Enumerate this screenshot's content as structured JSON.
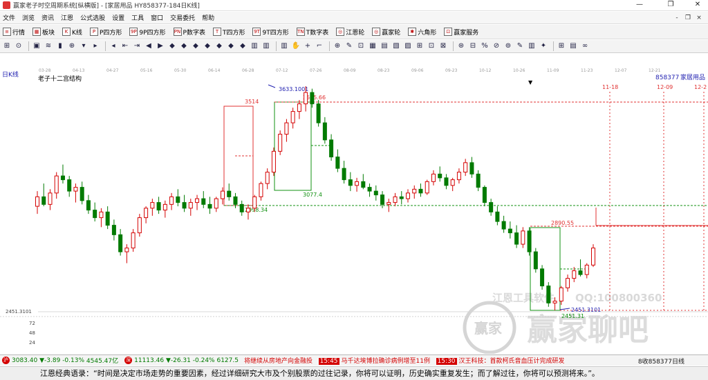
{
  "window": {
    "title": "赢家老子时空周期系统[纵横版] - [家居用品  HY858377-184日K线]",
    "minimize_glyph": "—",
    "maximize_glyph": "❐",
    "close_glyph": "✕"
  },
  "menu": {
    "items": [
      "文件",
      "浏览",
      "资讯",
      "江恩",
      "公式选股",
      "设置",
      "工具",
      "窗口",
      "交易委托",
      "帮助"
    ],
    "mdi_minimize": "-",
    "mdi_restore": "❐",
    "mdi_close": "×"
  },
  "toolbar1": {
    "items": [
      {
        "label": "行情",
        "icon": "≡"
      },
      {
        "label": "板块",
        "icon": "▦"
      },
      {
        "label": "K线",
        "icon": "K"
      },
      {
        "label": "P四方形",
        "icon": "P"
      },
      {
        "label": "9P四方形",
        "icon": "9P"
      },
      {
        "label": "P数字表",
        "icon": "PN"
      },
      {
        "label": "T四方形",
        "icon": "T"
      },
      {
        "label": "9T四方形",
        "icon": "9T"
      },
      {
        "label": "T数字表",
        "icon": "TN"
      },
      {
        "label": "江恩轮",
        "icon": "◎"
      },
      {
        "label": "赢家轮",
        "icon": "◎"
      },
      {
        "label": "六角形",
        "icon": "✱"
      },
      {
        "label": "赢家服务",
        "icon": "⊡"
      }
    ]
  },
  "toolbar2": {
    "icons": [
      "⊞",
      "⊙",
      "▣",
      "≋",
      "▮",
      "⊕",
      "▾",
      "▸",
      "◂",
      "⇤",
      "⇥",
      "◀",
      "▶",
      "◆",
      "◆",
      "◆",
      "◆",
      "◆",
      "◆",
      "◆",
      "▥",
      "▥",
      "▥",
      "✋",
      "+",
      "⌐",
      "⊕",
      "✎",
      "⊡",
      "▦",
      "▤",
      "▧",
      "▨",
      "⊞",
      "⊡",
      "⊠",
      "⊛",
      "⊟",
      "%",
      "⊘",
      "⊚",
      "✎",
      "▥",
      "✦",
      "⊞",
      "▤",
      "∞"
    ]
  },
  "chart": {
    "period_label": "日K线",
    "structure_label": "老子十二宫结构",
    "code": "858377",
    "name": "家居用品",
    "date_ticks": [
      "03-28",
      "04-13",
      "04-27",
      "05-16",
      "05-30",
      "06-14",
      "06-28",
      "07-12",
      "07-26",
      "08-09",
      "08-23",
      "09-06",
      "09-23",
      "10-12",
      "10-26",
      "11-09",
      "11-23",
      "12-07",
      "12-21"
    ],
    "forecast_dates": [
      "11-18",
      "12-09",
      "12-2"
    ],
    "price_labels": {
      "high": "3633.1001",
      "box_top_left": "3514",
      "box_top_right": "3535.66",
      "box_bottom": "2998.34",
      "mid_low": "3077.4",
      "right_level": "2890.55",
      "low_a": "2451.3101",
      "low_b": "2451.31",
      "axis_low": "2451.3101"
    },
    "volume_ticks": [
      "72",
      "48",
      "24"
    ],
    "watermark_1": "江恩工具软件",
    "watermark_2": "QQ:100800360",
    "watermark_3": "赢家聊吧",
    "watermark_logo": "赢家",
    "sort_glyph": "▼",
    "colors": {
      "up": "#d40000",
      "down": "#007a00",
      "box_red": "#e03030",
      "box_green": "#109010",
      "blue_label": "#2020b0"
    }
  },
  "chart_data": {
    "type": "candlestick",
    "title": "家居用品 HY858377 日K线",
    "ohlc_approx": [
      [
        3000,
        3080,
        2960,
        3050
      ],
      [
        3050,
        3120,
        3000,
        3010
      ],
      [
        3010,
        3090,
        2980,
        3070
      ],
      [
        3070,
        3180,
        3040,
        3160
      ],
      [
        3160,
        3220,
        3120,
        3140
      ],
      [
        3140,
        3160,
        3050,
        3080
      ],
      [
        3080,
        3120,
        3020,
        3100
      ],
      [
        3100,
        3130,
        3010,
        3030
      ],
      [
        3030,
        3060,
        2960,
        2980
      ],
      [
        2980,
        3020,
        2920,
        2940
      ],
      [
        2940,
        2990,
        2890,
        2970
      ],
      [
        2970,
        3000,
        2880,
        2900
      ],
      [
        2900,
        2930,
        2820,
        2850
      ],
      [
        2850,
        2880,
        2740,
        2760
      ],
      [
        2760,
        2800,
        2700,
        2780
      ],
      [
        2780,
        2880,
        2760,
        2860
      ],
      [
        2860,
        2960,
        2840,
        2940
      ],
      [
        2940,
        3000,
        2910,
        2990
      ],
      [
        2990,
        3040,
        2950,
        3020
      ],
      [
        3020,
        3050,
        2960,
        2980
      ],
      [
        2980,
        3030,
        2940,
        3010
      ],
      [
        3010,
        3070,
        2980,
        3050
      ],
      [
        3050,
        3090,
        3000,
        3020
      ],
      [
        3020,
        3060,
        2970,
        2990
      ],
      [
        2990,
        3040,
        2950,
        3020
      ],
      [
        3020,
        3060,
        2980,
        3040
      ],
      [
        3040,
        3080,
        2990,
        3010
      ],
      [
        3010,
        3050,
        2960,
        2990
      ],
      [
        2990,
        3050,
        2970,
        3040
      ],
      [
        3040,
        3100,
        3010,
        3080
      ],
      [
        3080,
        3120,
        3030,
        3050
      ],
      [
        3050,
        3070,
        2990,
        3010
      ],
      [
        3010,
        3030,
        2950,
        2970
      ],
      [
        2970,
        3010,
        2930,
        2990
      ],
      [
        2990,
        3060,
        2970,
        3050
      ],
      [
        3050,
        3130,
        3030,
        3120
      ],
      [
        3120,
        3200,
        3090,
        3180
      ],
      [
        3180,
        3310,
        3160,
        3290
      ],
      [
        3290,
        3400,
        3270,
        3380
      ],
      [
        3380,
        3460,
        3340,
        3440
      ],
      [
        3440,
        3520,
        3410,
        3500
      ],
      [
        3500,
        3560,
        3460,
        3540
      ],
      [
        3540,
        3633,
        3500,
        3600
      ],
      [
        3600,
        3620,
        3520,
        3540
      ],
      [
        3540,
        3560,
        3420,
        3440
      ],
      [
        3440,
        3470,
        3330,
        3350
      ],
      [
        3350,
        3380,
        3240,
        3260
      ],
      [
        3260,
        3300,
        3180,
        3200
      ],
      [
        3200,
        3240,
        3120,
        3140
      ],
      [
        3140,
        3180,
        3080,
        3110
      ],
      [
        3110,
        3150,
        3077,
        3130
      ],
      [
        3130,
        3170,
        3090,
        3100
      ],
      [
        3100,
        3120,
        3050,
        3080
      ],
      [
        3080,
        3110,
        3030,
        3060
      ],
      [
        3060,
        3080,
        2990,
        3010
      ],
      [
        3010,
        3040,
        2970,
        3020
      ],
      [
        3020,
        3070,
        3000,
        3050
      ],
      [
        3050,
        3080,
        3010,
        3040
      ],
      [
        3040,
        3090,
        3020,
        3070
      ],
      [
        3070,
        3110,
        3040,
        3090
      ],
      [
        3090,
        3120,
        3050,
        3070
      ],
      [
        3070,
        3140,
        3060,
        3130
      ],
      [
        3130,
        3190,
        3110,
        3170
      ],
      [
        3170,
        3210,
        3130,
        3150
      ],
      [
        3150,
        3170,
        3090,
        3110
      ],
      [
        3110,
        3150,
        3080,
        3140
      ],
      [
        3140,
        3200,
        3120,
        3180
      ],
      [
        3180,
        3250,
        3160,
        3230
      ],
      [
        3230,
        3260,
        3150,
        3170
      ],
      [
        3170,
        3190,
        3080,
        3100
      ],
      [
        3100,
        3110,
        3000,
        3020
      ],
      [
        3020,
        3040,
        2950,
        2970
      ],
      [
        2970,
        3000,
        2900,
        2920
      ],
      [
        2920,
        2950,
        2860,
        2880
      ],
      [
        2880,
        2920,
        2830,
        2860
      ],
      [
        2860,
        2900,
        2780,
        2800
      ],
      [
        2800,
        2890,
        2780,
        2870
      ],
      [
        2870,
        2890,
        2740,
        2760
      ],
      [
        2760,
        2780,
        2650,
        2670
      ],
      [
        2670,
        2690,
        2560,
        2580
      ],
      [
        2580,
        2600,
        2470,
        2490
      ],
      [
        2490,
        2520,
        2451,
        2500
      ],
      [
        2500,
        2580,
        2480,
        2570
      ],
      [
        2570,
        2640,
        2550,
        2620
      ],
      [
        2620,
        2680,
        2600,
        2660
      ],
      [
        2660,
        2720,
        2630,
        2640
      ],
      [
        2640,
        2700,
        2620,
        2690
      ],
      [
        2690,
        2800,
        2680,
        2780
      ]
    ],
    "levels": {
      "high": 3633.1001,
      "low": 2451.3101,
      "mid": 2998.34,
      "resistance": 2890.55
    }
  },
  "status": {
    "idx1_value": "3083.40",
    "idx1_change": "▼-3.89",
    "idx1_pct": "-0.13%",
    "idx1_amount": "4545.47亿",
    "idx2_value": "11113.46",
    "idx2_change": "▼-26.31",
    "idx2_pct": "-0.24%",
    "idx2_amount": "6127.5",
    "news_1": "将继续从房地产向金融投",
    "news_2_time": "15:45",
    "news_2": "马千达埃博拉确诊病例增至11例",
    "news_3_time": "15:30",
    "news_3": "汉王科技：首款柯氏音血压计完成研发",
    "right_label": "8收858377日线",
    "idx_badge": "沪",
    "idx2_badge": "深"
  },
  "quote": {
    "text": "江恩经典语录：“时间是决定市场走势的重要因素，经过详细研究大市及个别股票的过往记录，你将可以证明，历史确实重复发生；而了解过往，你将可以预测将来。”。"
  }
}
